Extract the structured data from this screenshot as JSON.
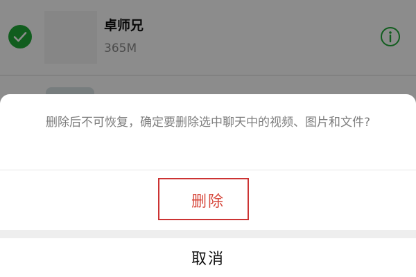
{
  "list": {
    "items": [
      {
        "name": "卓师兄",
        "size": "365M",
        "checked": true,
        "check_icon": "checkmark-icon",
        "info_icon": "info-icon"
      }
    ]
  },
  "sheet": {
    "message": "删除后不可恢复，确定要删除选中聊天中的视频、图片和文件?",
    "delete_label": "删除",
    "cancel_label": "取消"
  },
  "colors": {
    "check_green": "#1faa38",
    "delete_red": "#d6463a",
    "highlight_box": "#cc3333",
    "overlay": "rgba(0,0,0,0.45)"
  }
}
